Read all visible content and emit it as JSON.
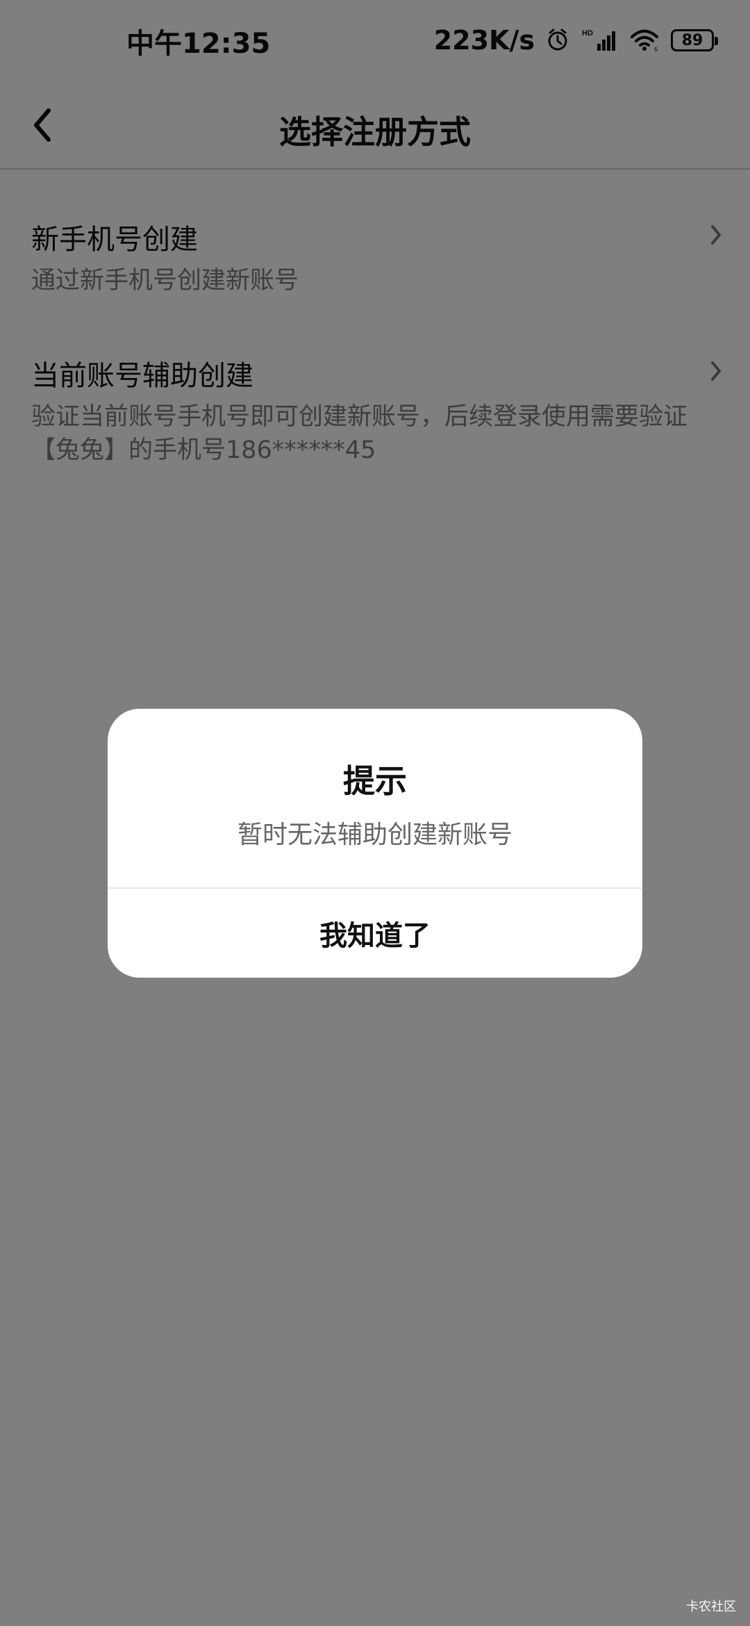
{
  "status_bar": {
    "time": "中午12:35",
    "network_speed": "223K/s",
    "battery": "89",
    "icons": [
      "alarm-icon",
      "hd-signal-icon",
      "wifi-icon",
      "battery-icon"
    ]
  },
  "app_bar": {
    "title": "选择注册方式",
    "back_icon": "back-arrow-icon"
  },
  "options": [
    {
      "title": "新手机号创建",
      "description": "通过新手机号创建新账号"
    },
    {
      "title": "当前账号辅助创建",
      "description": "验证当前账号手机号即可创建新账号，后续登录使用需要验证【兔兔】的手机号186******45"
    }
  ],
  "dialog": {
    "title": "提示",
    "message": "暂时无法辅助创建新账号",
    "button_label": "我知道了"
  },
  "watermark": "卡农社区"
}
